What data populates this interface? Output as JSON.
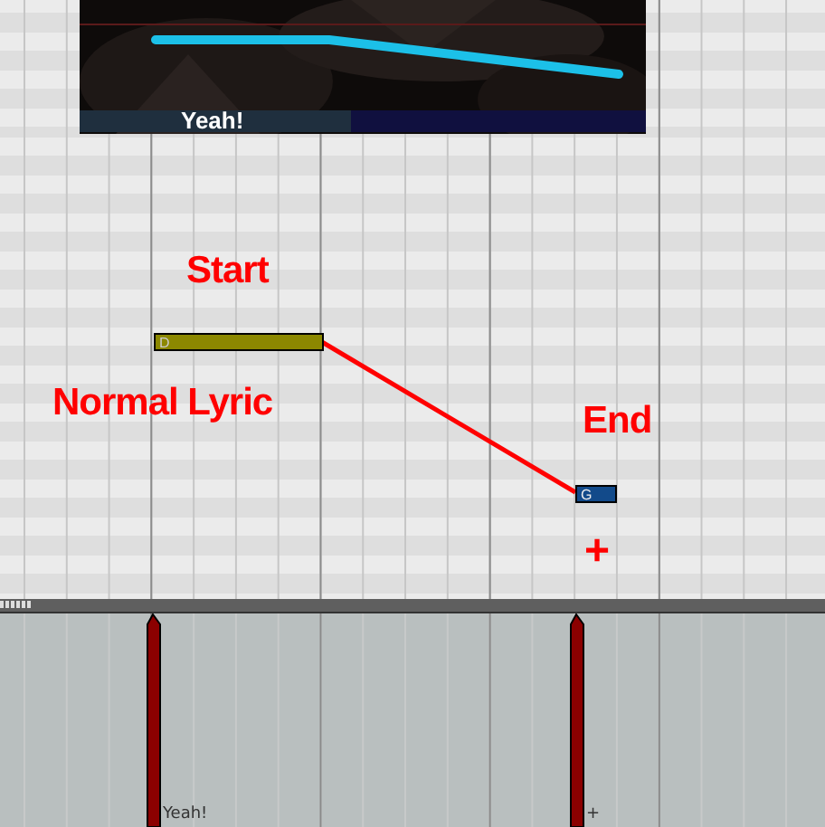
{
  "preview": {
    "lyric": "Yeah!"
  },
  "notes": [
    {
      "pitch": "D",
      "selected": false
    },
    {
      "pitch": "G",
      "selected": true
    }
  ],
  "annotations": [
    "Start",
    "Normal Lyric",
    "End",
    "+"
  ],
  "lane_markers": [
    {
      "label": "Yeah!"
    },
    {
      "label": "+"
    }
  ]
}
